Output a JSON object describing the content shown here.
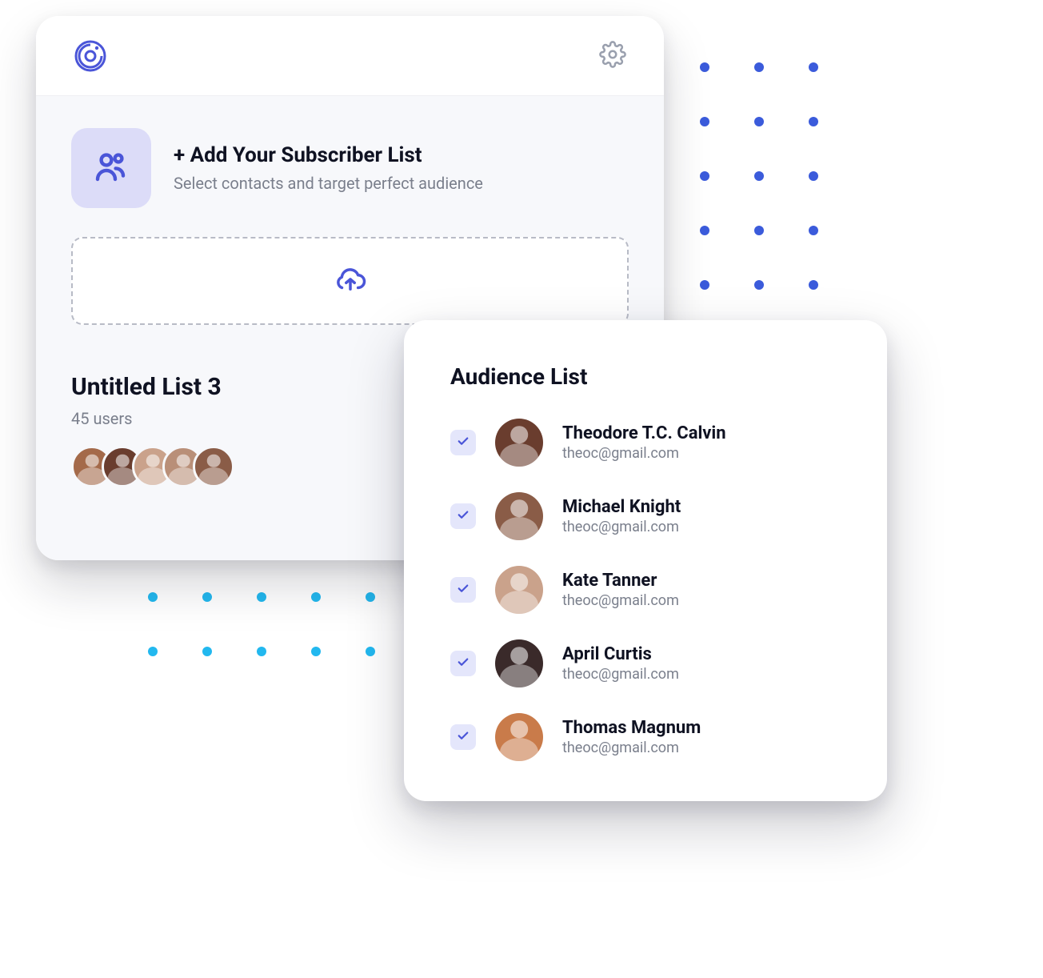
{
  "header": {
    "add_title": "+ Add Your Subscriber List",
    "add_subtitle": "Select contacts and target perfect audience"
  },
  "list": {
    "title": "Untitled List 3",
    "user_count": "45 users",
    "avatar_colors": [
      "#a46a4a",
      "#6a3d2e",
      "#caa28b",
      "#b98f78",
      "#8a5c47"
    ]
  },
  "audience": {
    "title": "Audience List",
    "items": [
      {
        "name": "Theodore T.C. Calvin",
        "email": "theoc@gmail.com",
        "checked": true,
        "color": "#6a3d2e"
      },
      {
        "name": "Michael Knight",
        "email": "theoc@gmail.com",
        "checked": true,
        "color": "#8a5c47"
      },
      {
        "name": "Kate Tanner",
        "email": "theoc@gmail.com",
        "checked": true,
        "color": "#caa28b"
      },
      {
        "name": "April Curtis",
        "email": "theoc@gmail.com",
        "checked": true,
        "color": "#3a2a2a"
      },
      {
        "name": "Thomas Magnum",
        "email": "theoc@gmail.com",
        "checked": true,
        "color": "#c97b4a"
      }
    ]
  },
  "colors": {
    "accent": "#4a55d8",
    "dot_blue": "#3b5bdb",
    "dot_cyan": "#22b8ef"
  }
}
